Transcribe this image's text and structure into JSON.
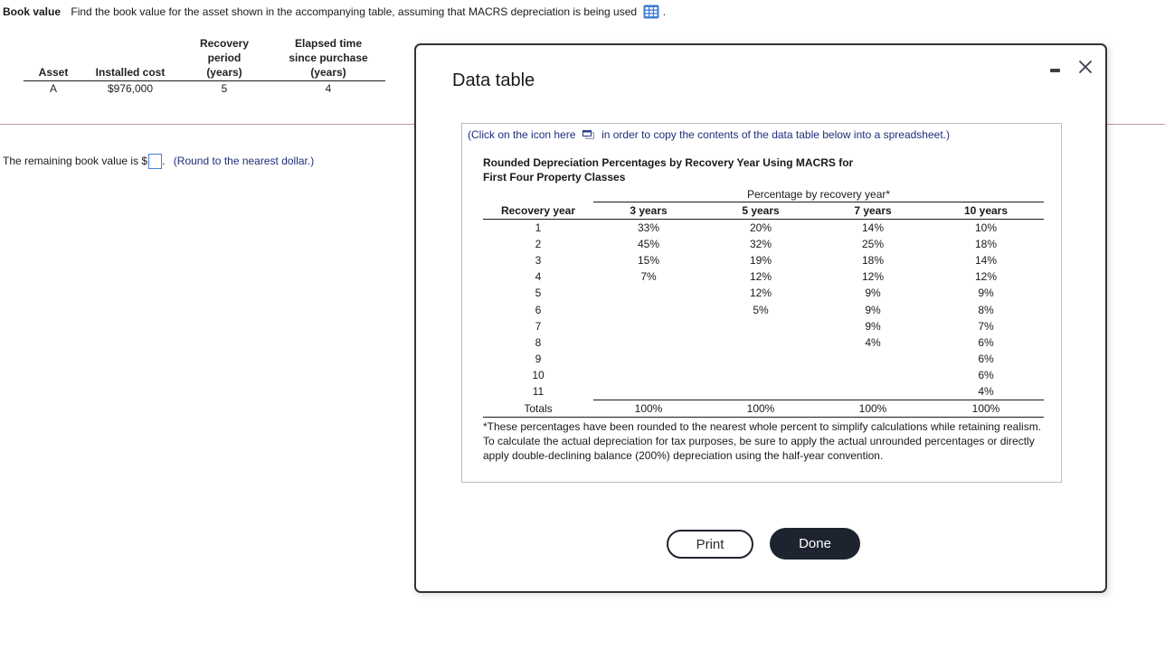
{
  "question": {
    "title": "Book value",
    "prompt": "Find the book value for the asset shown in the accompanying table, assuming that MACRS depreciation is being used",
    "data_icon": "grid-table-icon",
    "trailing": "."
  },
  "asset_table": {
    "headers": [
      "Asset",
      "Installed cost",
      "Recovery\nperiod\n(years)",
      "Elapsed time\nsince purchase\n(years)"
    ],
    "header_lines": {
      "asset": [
        "Asset"
      ],
      "cost": [
        "Installed cost"
      ],
      "recovery": [
        "Recovery",
        "period",
        "(years)"
      ],
      "elapsed": [
        "Elapsed time",
        "since purchase",
        "(years)"
      ]
    },
    "rows": [
      {
        "asset": "A",
        "cost": "$976,000",
        "recovery": "5",
        "elapsed": "4"
      }
    ]
  },
  "answer": {
    "prefix": "The remaining book value is $",
    "value": "",
    "suffix": ".",
    "hint": "(Round to the nearest dollar.)"
  },
  "modal": {
    "title": "Data table",
    "minimize_icon": "minimize-icon",
    "close_icon": "close-icon",
    "copy_prefix": "(Click on the icon here",
    "copy_suffix": "in order to copy the contents of the data table below into a spreadsheet.)",
    "table_title_line1": "Rounded Depreciation Percentages by Recovery Year Using MACRS for",
    "table_title_line2": "First Four Property Classes",
    "group_header": "Percentage by recovery year*",
    "columns": [
      "Recovery year",
      "3 years",
      "5 years",
      "7 years",
      "10 years"
    ],
    "rows": [
      [
        "1",
        "33%",
        "20%",
        "14%",
        "10%"
      ],
      [
        "2",
        "45%",
        "32%",
        "25%",
        "18%"
      ],
      [
        "3",
        "15%",
        "19%",
        "18%",
        "14%"
      ],
      [
        "4",
        "7%",
        "12%",
        "12%",
        "12%"
      ],
      [
        "5",
        "",
        "12%",
        "9%",
        "9%"
      ],
      [
        "6",
        "",
        "5%",
        "9%",
        "8%"
      ],
      [
        "7",
        "",
        "",
        "9%",
        "7%"
      ],
      [
        "8",
        "",
        "",
        "4%",
        "6%"
      ],
      [
        "9",
        "",
        "",
        "",
        "6%"
      ],
      [
        "10",
        "",
        "",
        "",
        "6%"
      ],
      [
        "11",
        "",
        "",
        "",
        "4%"
      ]
    ],
    "totals": [
      "Totals",
      "100%",
      "100%",
      "100%",
      "100%"
    ],
    "footnote": "*These percentages have been rounded to the nearest whole percent to simplify calculations while retaining realism. To calculate the actual depreciation for tax purposes, be sure to apply the actual unrounded percentages or directly apply double-declining balance (200%) depreciation using the half-year convention.",
    "print_label": "Print",
    "done_label": "Done"
  },
  "colors": {
    "hint_text": "#1f2d7a",
    "button_dark": "#1e2330",
    "icon_blue": "#3b7bd8",
    "divider": "#b89aa6"
  }
}
